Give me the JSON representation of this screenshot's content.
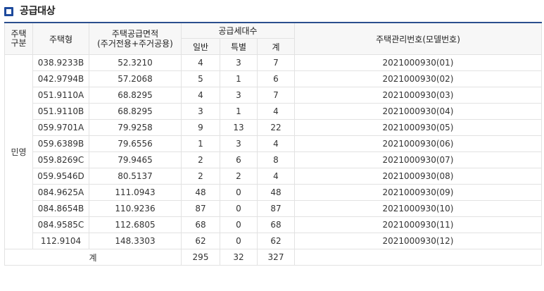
{
  "section": {
    "title": "공급대상",
    "icon": "square-bullet-icon",
    "accent_color": "#1e4a9c"
  },
  "table": {
    "headers": {
      "housing_type_group": "주택\n구분",
      "housing_model": "주택형",
      "area": "주택공급면적\n(주거전용+주거공용)",
      "supply_units": "공급세대수",
      "general": "일반",
      "special": "특별",
      "total": "계",
      "mgmt_number": "주택관리번호(모델번호)"
    },
    "group_label": "민영",
    "rows": [
      {
        "type": "038.9233B",
        "area": "52.3210",
        "general": "4",
        "special": "3",
        "total": "7",
        "code": "2021000930(01)"
      },
      {
        "type": "042.9794B",
        "area": "57.2068",
        "general": "5",
        "special": "1",
        "total": "6",
        "code": "2021000930(02)"
      },
      {
        "type": "051.9110A",
        "area": "68.8295",
        "general": "4",
        "special": "3",
        "total": "7",
        "code": "2021000930(03)"
      },
      {
        "type": "051.9110B",
        "area": "68.8295",
        "general": "3",
        "special": "1",
        "total": "4",
        "code": "2021000930(04)"
      },
      {
        "type": "059.9701A",
        "area": "79.9258",
        "general": "9",
        "special": "13",
        "total": "22",
        "code": "2021000930(05)"
      },
      {
        "type": "059.6389B",
        "area": "79.6556",
        "general": "1",
        "special": "3",
        "total": "4",
        "code": "2021000930(06)"
      },
      {
        "type": "059.8269C",
        "area": "79.9465",
        "general": "2",
        "special": "6",
        "total": "8",
        "code": "2021000930(07)"
      },
      {
        "type": "059.9546D",
        "area": "80.5137",
        "general": "2",
        "special": "2",
        "total": "4",
        "code": "2021000930(08)"
      },
      {
        "type": "084.9625A",
        "area": "111.0943",
        "general": "48",
        "special": "0",
        "total": "48",
        "code": "2021000930(09)"
      },
      {
        "type": "084.8654B",
        "area": "110.9236",
        "general": "87",
        "special": "0",
        "total": "87",
        "code": "2021000930(10)"
      },
      {
        "type": "084.9585C",
        "area": "112.6805",
        "general": "68",
        "special": "0",
        "total": "68",
        "code": "2021000930(11)"
      },
      {
        "type": "112.9104",
        "area": "148.3303",
        "general": "62",
        "special": "0",
        "total": "62",
        "code": "2021000930(12)"
      }
    ],
    "footer": {
      "label": "계",
      "general": "295",
      "special": "32",
      "total": "327"
    }
  }
}
